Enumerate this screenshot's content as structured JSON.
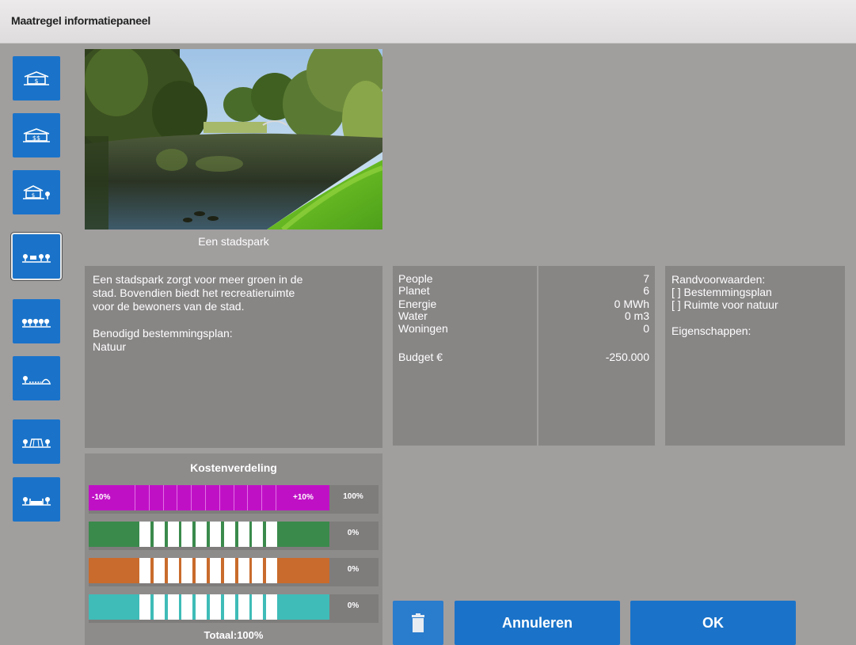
{
  "window": {
    "title": "Maatregel informatiepaneel"
  },
  "sidebar": {
    "items": [
      {
        "icon": "house-dollar-icon"
      },
      {
        "icon": "house-double-dollar-icon"
      },
      {
        "icon": "house-dollar-tree-icon"
      },
      {
        "icon": "trees-fence-icon",
        "active": true
      },
      {
        "icon": "row-of-trees-icon"
      },
      {
        "icon": "tree-bridge-icon"
      },
      {
        "icon": "trees-shelter-icon"
      },
      {
        "icon": "trees-pond-icon"
      }
    ]
  },
  "measure": {
    "image_caption": "Een stadspark",
    "description_lines": [
      "Een stadspark zorgt voor meer groen in de",
      "stad. Bovendien biedt het recreatieruimte",
      "voor de bewoners van de stad."
    ],
    "zoning_label": "Benodigd bestemmingsplan:",
    "zoning_value": "Natuur"
  },
  "stats": [
    {
      "label": "People",
      "value": "7"
    },
    {
      "label": "Planet",
      "value": "6"
    },
    {
      "label": "Energie",
      "value": "0 MWh"
    },
    {
      "label": "Water",
      "value": "0 m3"
    },
    {
      "label": "Woningen",
      "value": "0"
    },
    {
      "label": "Budget  €",
      "value": "-250.000"
    }
  ],
  "conditions": {
    "title": "Randvoorwaarden:",
    "items": [
      "[   ] Bestemmingsplan",
      "[   ] Ruimte voor natuur"
    ],
    "properties_label": "Eigenschappen:"
  },
  "cost_distribution": {
    "title": "Kostenverdeling",
    "rows": [
      {
        "color": "#c010c6",
        "min_label": "-10%",
        "max_label": "+10%",
        "percent": "100%",
        "share": 1.0
      },
      {
        "color": "#3a8a4c",
        "min_label": "",
        "max_label": "",
        "percent": "0%",
        "share": 0.0
      },
      {
        "color": "#c96b2c",
        "min_label": "",
        "max_label": "",
        "percent": "0%",
        "share": 0.0
      },
      {
        "color": "#3fbcb8",
        "min_label": "",
        "max_label": "",
        "percent": "0%",
        "share": 0.0
      }
    ],
    "total": "Totaal:100%"
  },
  "actions": {
    "delete_icon": "trash-icon",
    "cancel_label": "Annuleren",
    "ok_label": "OK"
  },
  "colors": {
    "accent": "#1a73c9",
    "background": "#a19e9e",
    "panel": "#888585"
  }
}
